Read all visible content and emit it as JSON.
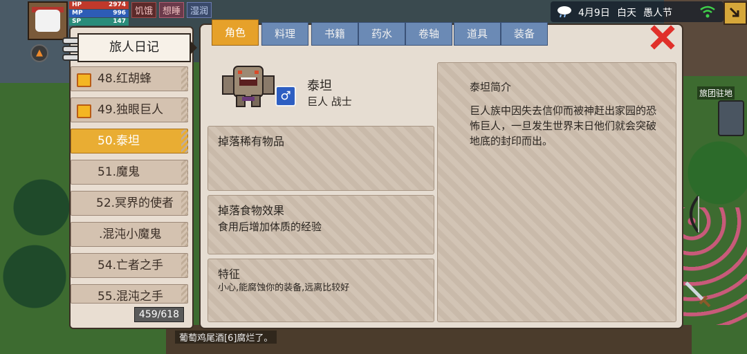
{
  "hud": {
    "hp_label": "HP",
    "hp_value": "2974",
    "mp_label": "MP",
    "mp_value": "996",
    "sp_label": "SP",
    "sp_value": "147",
    "status": [
      "饥饿",
      "想睡",
      "湿润"
    ]
  },
  "weather": {
    "date": "4月9日",
    "time_of_day": "白天",
    "festival": "愚人节"
  },
  "side": {
    "camp_label": "旅团驻地"
  },
  "diary": {
    "title": "旅人日记",
    "entries": [
      {
        "label": "48.红胡蜂",
        "has_book_icon": true
      },
      {
        "label": "49.独眼巨人",
        "has_book_icon": true
      },
      {
        "label": "50.泰坦",
        "active": true
      },
      {
        "label": "51.魔鬼"
      },
      {
        "label": "52.冥界的使者"
      },
      {
        "label": ".混沌小魔鬼"
      },
      {
        "label": "54.亡者之手"
      },
      {
        "label": "55.混沌之手"
      }
    ],
    "counter": "459/618"
  },
  "tabs": [
    "角色",
    "料理",
    "书籍",
    "药水",
    "卷轴",
    "道具",
    "装备"
  ],
  "monster": {
    "name": "泰坦",
    "type": "巨人 战士",
    "gender_symbol": "♂",
    "rare_drop_title": "掉落稀有物品",
    "food_effect_title": "掉落食物效果",
    "food_effect_text": "食用后增加体质的经验",
    "trait_title": "特征",
    "trait_text": "小心,能腐蚀你的装备,远离比较好",
    "intro_title": "泰坦简介",
    "intro_text": "巨人族中因失去信仰而被神赶出家园的恐怖巨人，一旦发生世界末日他们就会突破地底的封印而出。"
  },
  "toast": "葡萄鸡尾酒[6]腐烂了。",
  "colors": {
    "tab_active": "#e6a12a",
    "tab_inactive": "#6b8ab5",
    "entry_active": "#e9ad33",
    "close": "#e0302a"
  }
}
